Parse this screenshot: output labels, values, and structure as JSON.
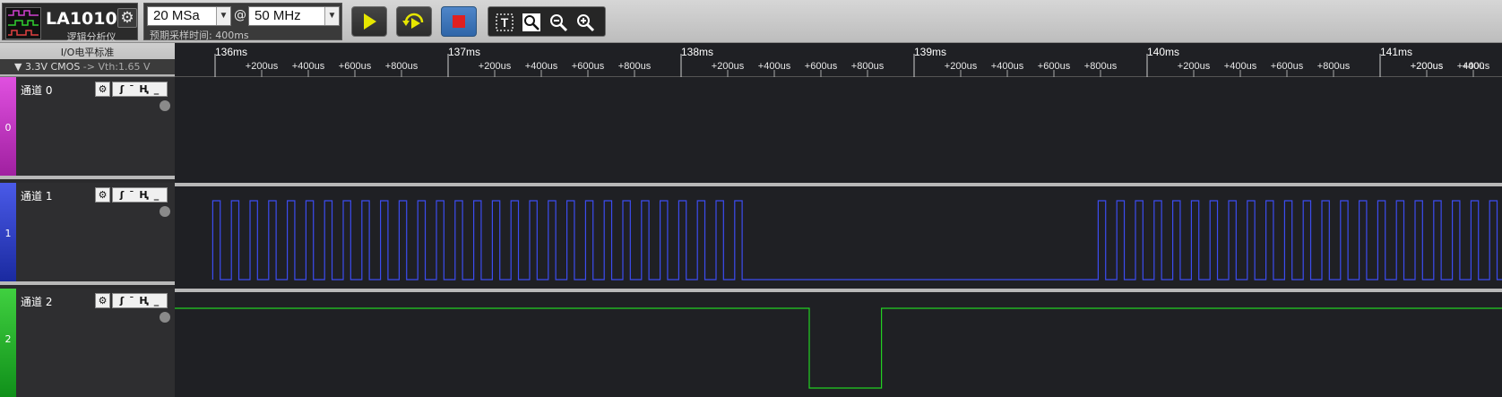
{
  "toolbar": {
    "device_name": "LA1010",
    "device_subtitle": "逻辑分析仪",
    "sample_depth": "20 MSa",
    "at_symbol": "@",
    "sample_rate": "50 MHz",
    "estimated_time": "预期采样时间: 400ms",
    "run_icon": "play-icon",
    "repeat_icon": "repeat-run-icon",
    "stop_icon": "stop-icon",
    "stop_color": "#e02020",
    "zoom_tools": [
      "text-tool-icon",
      "zoom-fit-icon",
      "zoom-out-icon",
      "zoom-in-icon"
    ]
  },
  "side_panel": {
    "io_title": "I/O电平标准",
    "io_standard": "3.3V CMOS",
    "io_arrow": "->",
    "io_vth": "Vth:1.65 V"
  },
  "channels": [
    {
      "index": "0",
      "name": "通道 0",
      "color": "#c832c8",
      "trigger_glyphs": "ʃ ¯ Ⱨ _"
    },
    {
      "index": "1",
      "name": "通道 1",
      "color": "#3848c8",
      "trigger_glyphs": "ʃ ¯ Ⱨ _"
    },
    {
      "index": "2",
      "name": "通道 2",
      "color": "#20b020",
      "trigger_glyphs": "ʃ ¯ Ⱨ _"
    }
  ],
  "ruler": {
    "major_labels": [
      "136ms",
      "137ms",
      "138ms",
      "139ms",
      "140ms",
      "141ms"
    ],
    "minor_labels": [
      "+200us",
      "+400us",
      "+600us",
      "+800us"
    ],
    "last_minor_label": "+200us",
    "last_partial_label": "+400"
  },
  "waveforms": {
    "ch1_color": "#3c4cf0",
    "ch2_color": "#22d022",
    "ch1_burst_1": {
      "start_ms": 136.0,
      "end_ms": 138.26,
      "edges_count": 28
    },
    "ch1_idle_low": {
      "start_ms": 138.26,
      "end_ms": 139.79
    },
    "ch1_burst_2": {
      "start_ms": 139.79,
      "end_ms": 141.66
    },
    "ch2_low_pulse": {
      "start_ms": 138.55,
      "end_ms": 138.86
    }
  }
}
